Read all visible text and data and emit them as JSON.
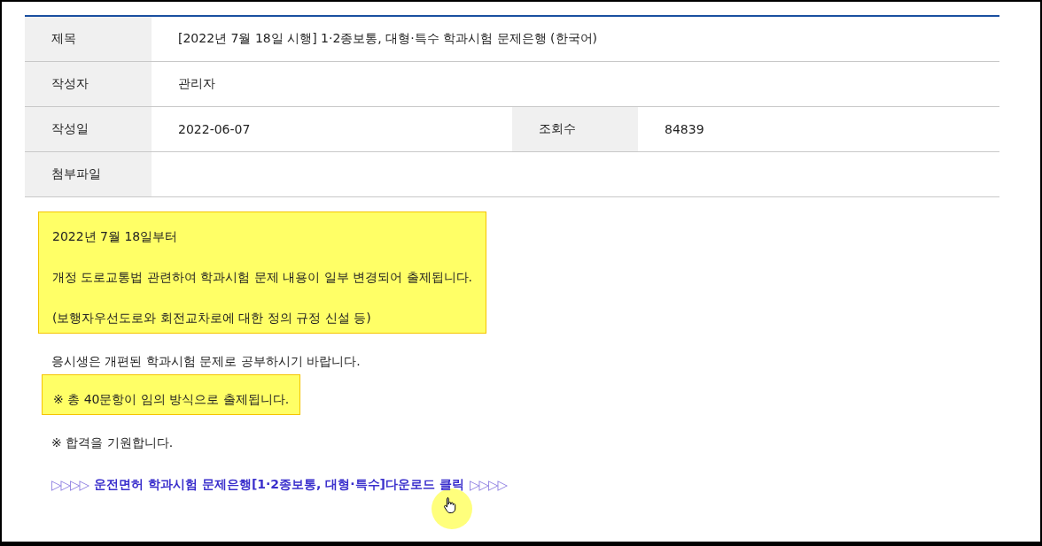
{
  "info_table": {
    "rows": [
      {
        "cells": [
          {
            "kind": "header",
            "text": "제목"
          },
          {
            "kind": "value",
            "text": "[2022년 7월 18일 시행] 1·2종보통, 대형·특수 학과시험 문제은행 (한국어)"
          }
        ]
      },
      {
        "cells": [
          {
            "kind": "header",
            "text": "작성자"
          },
          {
            "kind": "value",
            "text": "관리자"
          }
        ]
      },
      {
        "cells": [
          {
            "kind": "header",
            "text": "작성일"
          },
          {
            "kind": "value",
            "text": "2022-06-07"
          },
          {
            "kind": "header",
            "text": "조회수"
          },
          {
            "kind": "value",
            "text": "84839"
          }
        ]
      },
      {
        "cells": [
          {
            "kind": "header",
            "text": "첨부파일"
          },
          {
            "kind": "value",
            "text": ""
          }
        ]
      }
    ]
  },
  "content": [
    {
      "kind": "highlight",
      "lines": [
        "2022년 7월 18일부터",
        "개정 도로교통법 관련하여 학과시험 문제 내용이 일부 변경되어 출제됩니다.",
        "(보행자우선도로와 회전교차로에 대한 정의 규정 신설 등)"
      ]
    },
    {
      "kind": "paragraph",
      "text": "응시생은 개편된 학과시험 문제로 공부하시기 바랍니다."
    },
    {
      "kind": "highlight",
      "lines": [
        "※ 총 40문항이 임의 방식으로 출제됩니다."
      ]
    },
    {
      "kind": "paragraph",
      "text": "※ 합격을 기원합니다."
    },
    {
      "kind": "link",
      "lead": "▷▷▷▷",
      "text": "운전면허 학과시험 문제은행[1·2종보통, 대형·특수]다운로드 클릭",
      "trail": "▷▷▷▷"
    }
  ]
}
